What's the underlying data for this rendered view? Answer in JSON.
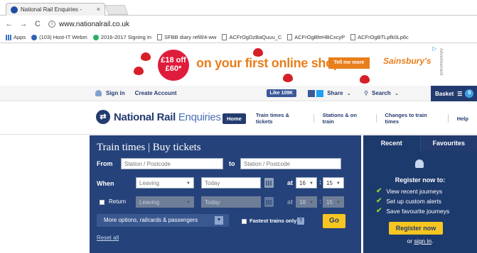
{
  "browser": {
    "tab_title": "National Rail Enquiries - ",
    "tab_close": "×",
    "url": "www.nationalrail.co.uk",
    "back": "←",
    "forward": "→",
    "reload": "C"
  },
  "bookmarks": [
    "Apps",
    "(103) Host-IT Webm",
    "2016-2017 Signing In",
    "SFBB diary refill/4-ww",
    "ACFrOgDzBaQuuu_C",
    "ACFrOgBfeHBCxcyP",
    "ACFrOgBTLpfk0Lp6c"
  ],
  "ad": {
    "badge_line1": "£18 off",
    "badge_line2": "£60*",
    "headline": "on your first online shop",
    "button": "Tell me more",
    "brand": "Sainsbury's",
    "label": "Advertisement"
  },
  "utility": {
    "sign_in": "Sign in",
    "create_account": "Create Account",
    "like": "Like 109K",
    "share": "Share",
    "search": "Search",
    "basket": "Basket",
    "basket_count": "0"
  },
  "nav": {
    "logo_bold": "National Rail",
    "logo_light": " Enquiries",
    "home": "Home",
    "links": [
      "Train times & tickets",
      "Stations & on train",
      "Changes to train times",
      "Help"
    ]
  },
  "planner": {
    "title": "Train times | Buy tickets",
    "from_label": "From",
    "from_placeholder": "Station / Postcode",
    "to_label": "to",
    "to_placeholder": "Station / Postcode",
    "when_label": "When",
    "when_select": "Leaving",
    "date_value": "Today",
    "at_label": "at",
    "hour": "16",
    "minute": "15",
    "return_label": "Return",
    "return_select": "Leaving",
    "return_date": "Today",
    "return_at": "at",
    "return_hour": "18",
    "return_minute": "15",
    "more_options": "More options, railcards & passengers",
    "fastest_only": "Fastest trains only",
    "help": "?",
    "go": "Go",
    "reset": "Reset all"
  },
  "side": {
    "tab_recent": "Recent",
    "tab_favourites": "Favourites",
    "register_title": "Register now to:",
    "benefits": [
      "View recent journeys",
      "Set up custom alerts",
      "Save favourite journeys"
    ],
    "register_button": "Register now",
    "or": "or ",
    "sign_in": "sign in",
    "period": "."
  }
}
